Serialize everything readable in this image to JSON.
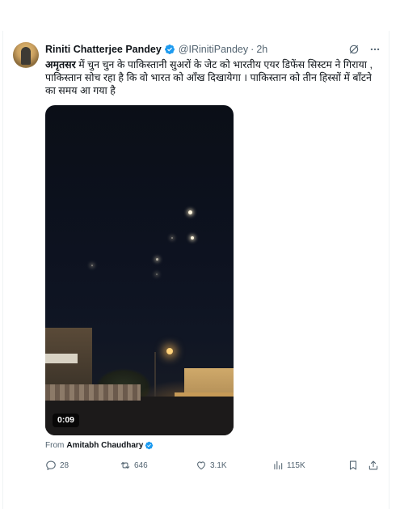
{
  "author": {
    "name": "Riniti Chatterjee Pandey",
    "handle": "@IRinitiPandey",
    "separator": "·",
    "time": "2h"
  },
  "text": {
    "bold_word": "अमृतसर",
    "body": " में चुन चुन के पाकिस्तानी सुअरों के जेट को भारतीय एयर डिफेंस सिस्टम ने गिराया , पाकिस्तान सोच रहा है कि वो भारत को आँख दिखायेगा । पाकिस्तान को तीन हिस्सों में बाँटने का समय आ गया है"
  },
  "media": {
    "duration": "0:09"
  },
  "attribution": {
    "prefix": "From",
    "source_name": "Amitabh Chaudhary"
  },
  "actions": {
    "replies": "28",
    "reposts": "646",
    "likes": "3.1K",
    "views": "115K"
  },
  "colors": {
    "verified": "#1d9bf0",
    "muted_text": "#536471",
    "primary_text": "#0f1419"
  },
  "icons": [
    "verified-badge-icon",
    "grok-icon",
    "more-icon",
    "reply-icon",
    "repost-icon",
    "like-icon",
    "views-icon",
    "bookmark-icon",
    "share-icon"
  ]
}
